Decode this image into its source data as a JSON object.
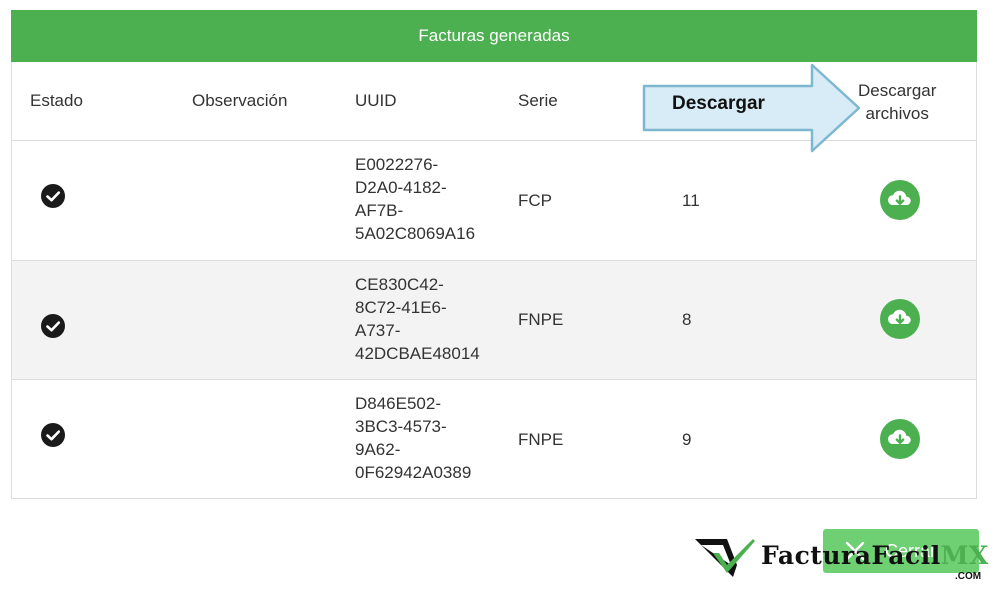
{
  "panel": {
    "title": "Facturas generadas"
  },
  "columns": {
    "estado": "Estado",
    "observacion": "Observación",
    "uuid": "UUID",
    "serie": "Serie",
    "descargar_line1": "Descargar",
    "descargar_line2": "archivos"
  },
  "rows": [
    {
      "uuid": [
        "E0022276-",
        "D2A0-4182-",
        "AF7B-",
        "5A02C8069A16"
      ],
      "serie": "FCP",
      "folio": "11",
      "status_icon": "check-circle-icon",
      "download_icon": "cloud-download-icon"
    },
    {
      "uuid": [
        "CE830C42-",
        "8C72-41E6-",
        "A737-",
        "42DCBAE48014"
      ],
      "serie": "FNPE",
      "folio": "8",
      "status_icon": "check-circle-icon",
      "download_icon": "cloud-download-icon"
    },
    {
      "uuid": [
        "D846E502-",
        "3BC3-4573-",
        "9A62-",
        "0F62942A0389"
      ],
      "serie": "FNPE",
      "folio": "9",
      "status_icon": "check-circle-icon",
      "download_icon": "cloud-download-icon"
    }
  ],
  "callout": {
    "label": "Descargar"
  },
  "footer": {
    "close_label": "Cerrar",
    "close_icon": "close-icon"
  },
  "logo": {
    "brand": "FacturaFacil",
    "suffix": "MX",
    "domain": ".COM"
  },
  "colors": {
    "accent": "#4caf50",
    "callout_fill": "#d7ecf6",
    "callout_stroke": "#7fb6d0"
  }
}
